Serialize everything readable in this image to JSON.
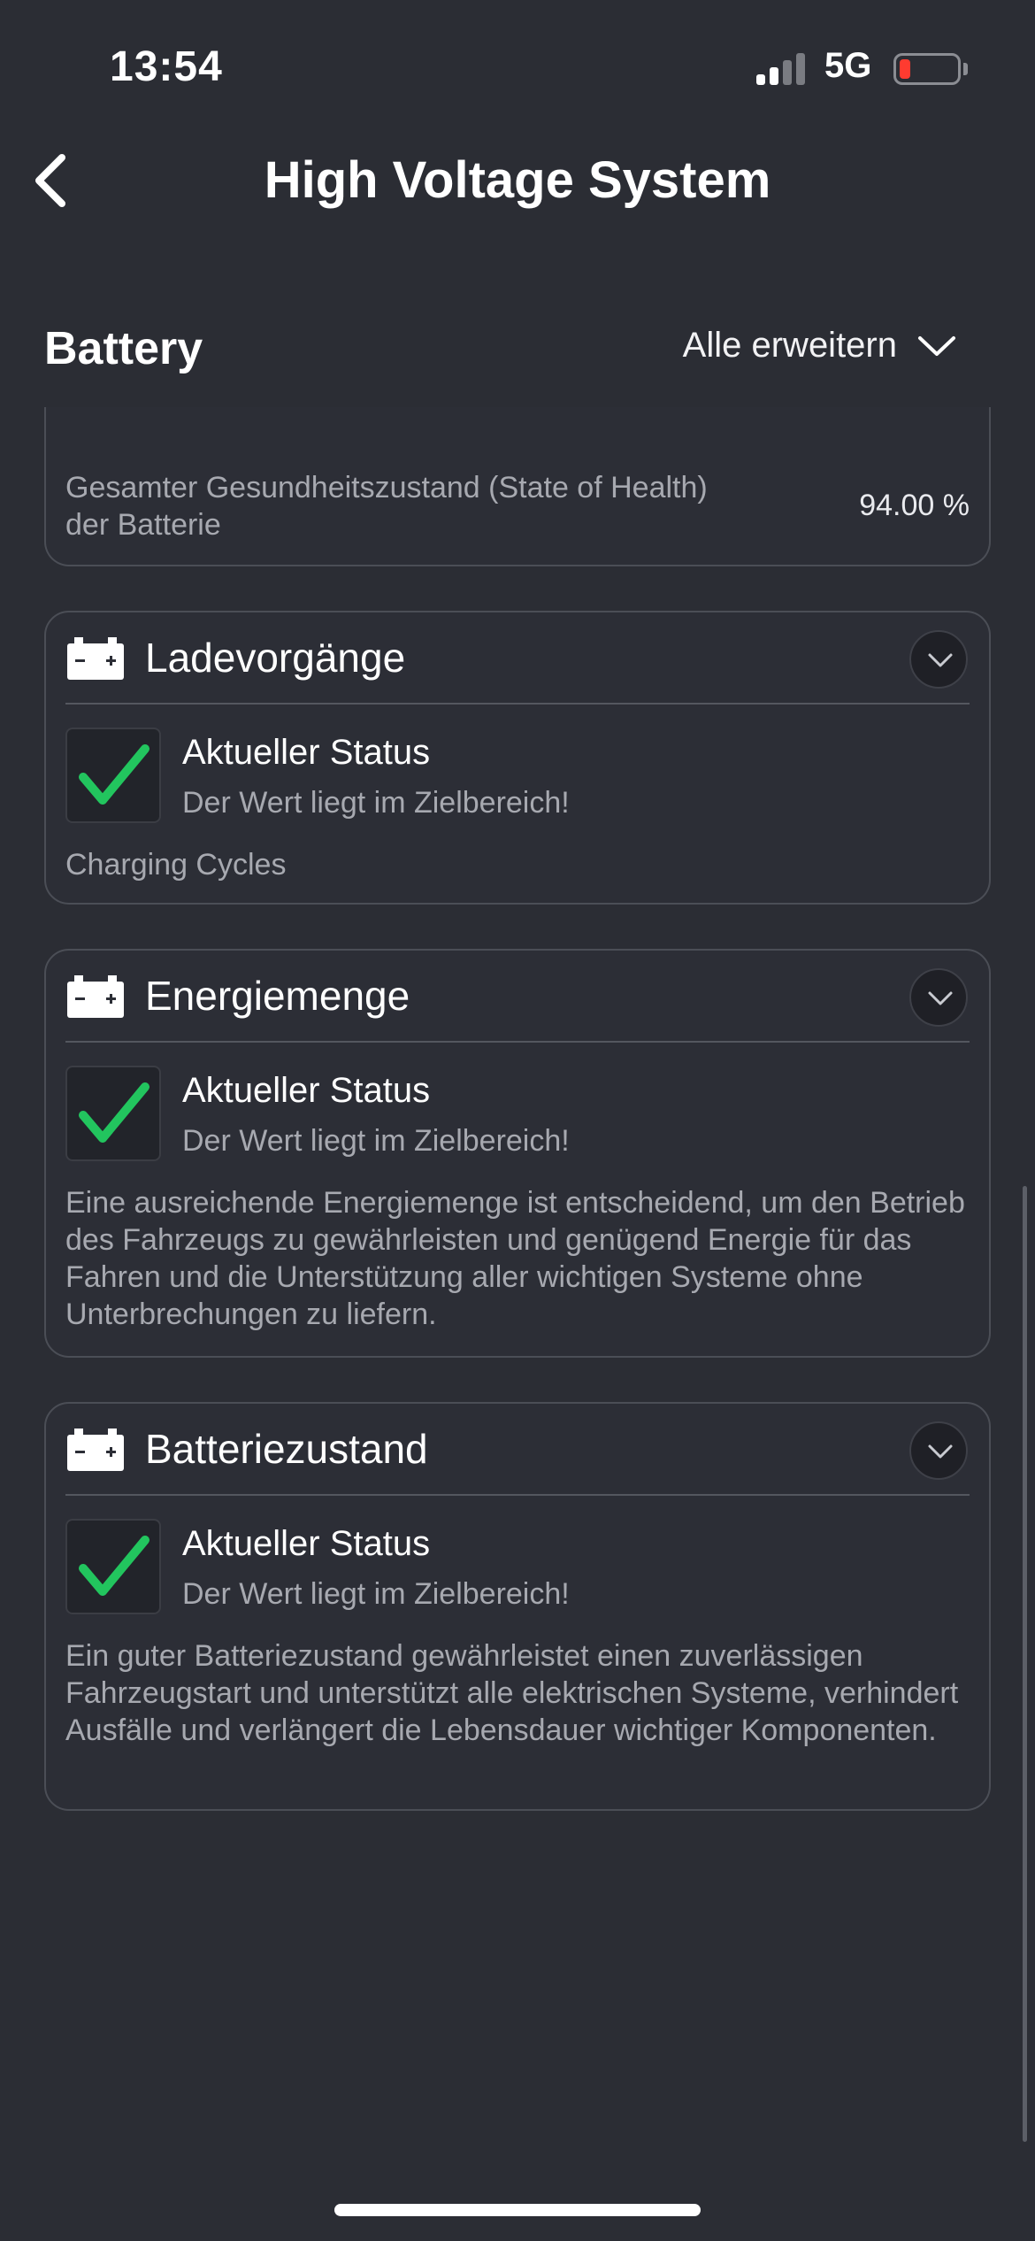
{
  "status_bar": {
    "time": "13:54",
    "network": "5G",
    "battery_color": "#ff3b30"
  },
  "nav": {
    "title": "High Voltage System",
    "back_icon": "chevron-left-icon"
  },
  "section": {
    "title": "Battery",
    "expand_all_label": "Alle erweitern",
    "expand_icon": "chevron-down-icon"
  },
  "soh": {
    "label": "Gesamter Gesundheitszustand (State of Health) der Batterie",
    "value": "94.00 %"
  },
  "cards": [
    {
      "title": "Ladevorgänge",
      "status_title": "Aktueller Status",
      "status_subtitle": "Der Wert liegt im Zielbereich!",
      "description": "Charging Cycles"
    },
    {
      "title": "Energiemenge",
      "status_title": "Aktueller Status",
      "status_subtitle": "Der Wert liegt im Zielbereich!",
      "description": "Eine ausreichende Energiemenge ist entscheidend, um den Betrieb des Fahrzeugs zu gewährleisten und genügend Energie für das Fahren und die Unterstützung aller wichtigen Systeme ohne Unterbrechungen zu liefern."
    },
    {
      "title": "Batteriezustand",
      "status_title": "Aktueller Status",
      "status_subtitle": "Der Wert liegt im Zielbereich!",
      "description": "Ein guter Batteriezustand gewährleistet einen zuverlässigen Fahrzeugstart und unterstützt alle elektrischen Systeme, verhindert Ausfälle und verlängert die Lebensdauer wichtiger Komponenten."
    }
  ],
  "colors": {
    "background": "#2b2d34",
    "check": "#22c55e",
    "border": "#4b4e56"
  }
}
